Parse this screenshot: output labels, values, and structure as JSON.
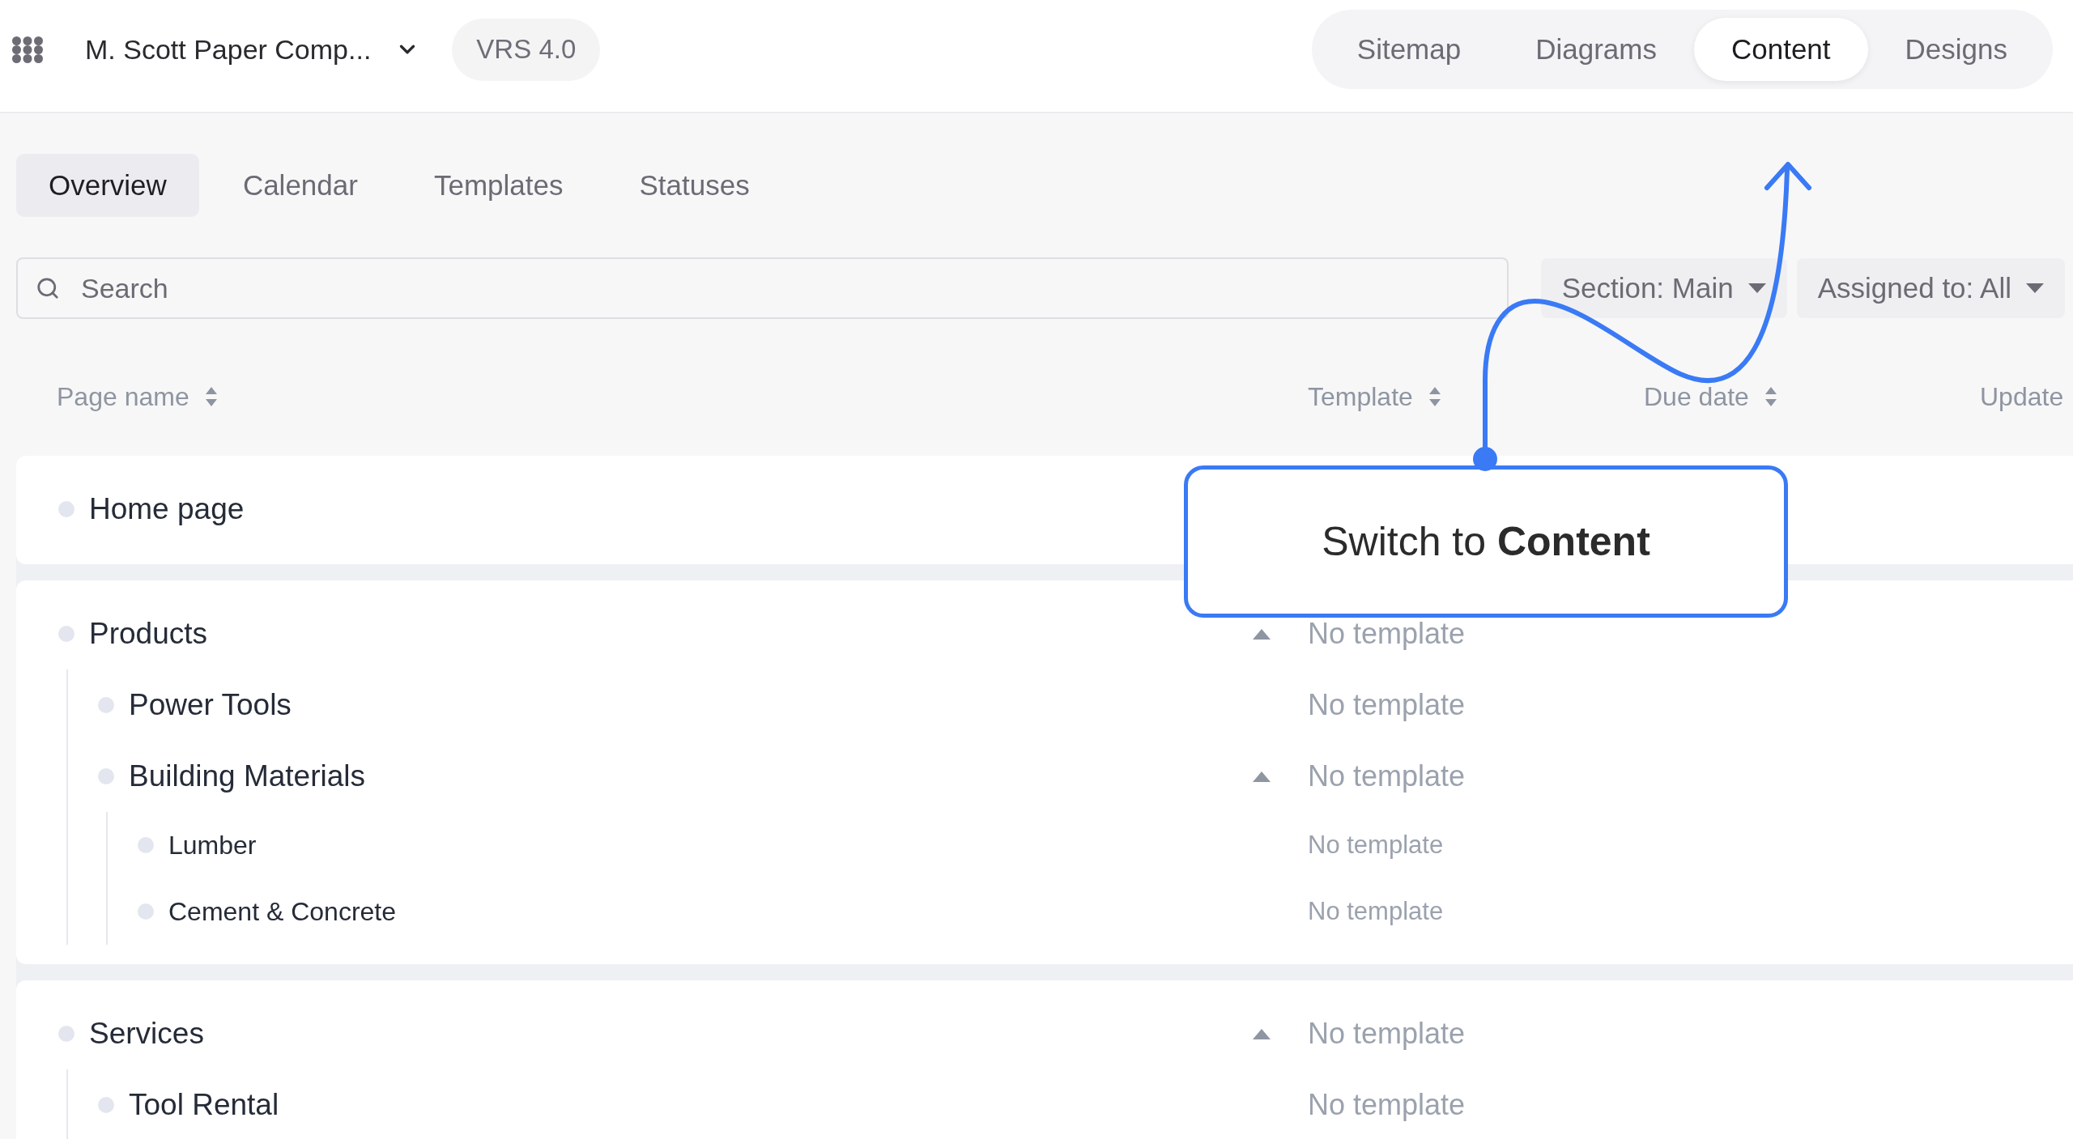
{
  "top_bar": {
    "project": "M. Scott Paper Comp...",
    "version": "VRS 4.0",
    "nav": [
      {
        "label": "Sitemap",
        "selected": false
      },
      {
        "label": "Diagrams",
        "selected": false
      },
      {
        "label": "Content",
        "selected": true
      },
      {
        "label": "Designs",
        "selected": false
      }
    ]
  },
  "tabs": [
    {
      "label": "Overview",
      "selected": true
    },
    {
      "label": "Calendar",
      "selected": false
    },
    {
      "label": "Templates",
      "selected": false
    },
    {
      "label": "Statuses",
      "selected": false
    }
  ],
  "search": {
    "placeholder": "Search"
  },
  "filters": [
    {
      "label": "Section: Main"
    },
    {
      "label": "Assigned to: All"
    }
  ],
  "table": {
    "columns": [
      {
        "label": "Page name",
        "sortable": true
      },
      {
        "label": "Template",
        "sortable": true
      },
      {
        "label": "Due date",
        "sortable": true
      },
      {
        "label": "Update"
      }
    ],
    "rows": [
      {
        "name": "Home page"
      },
      {
        "name": "Products",
        "expanded": true,
        "template": "No template",
        "children": [
          {
            "name": "Power Tools",
            "template": "No template"
          },
          {
            "name": "Building Materials",
            "expanded": true,
            "template": "No template",
            "children": [
              {
                "name": "Lumber",
                "template": "No template"
              },
              {
                "name": "Cement & Concrete",
                "template": "No template"
              }
            ]
          }
        ]
      },
      {
        "name": "Services",
        "expanded": true,
        "template": "No template",
        "children": [
          {
            "name": "Tool Rental",
            "template": "No template"
          }
        ]
      }
    ]
  },
  "callout": {
    "text": "Switch to **Content**"
  }
}
